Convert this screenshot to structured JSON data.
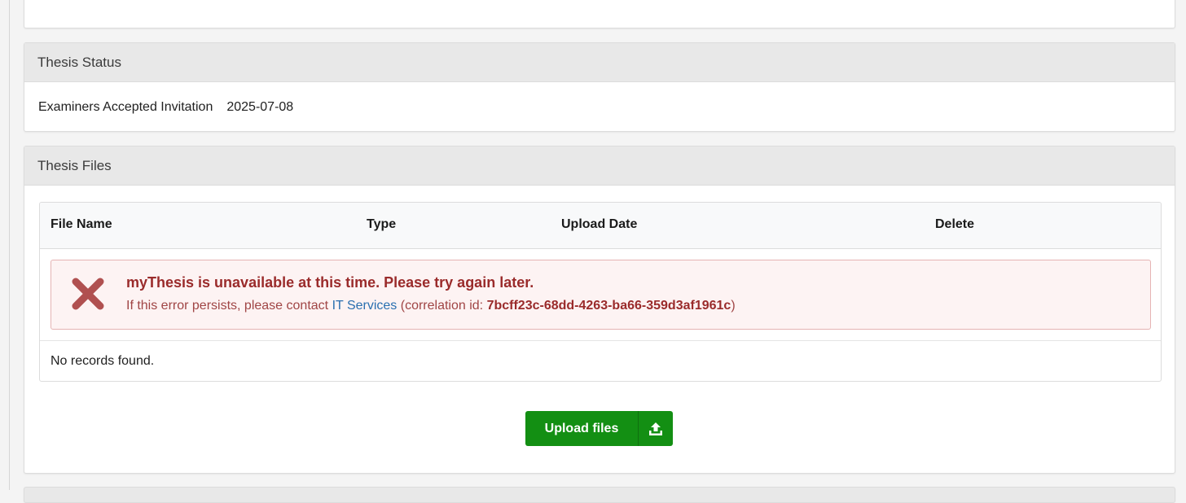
{
  "thesis_status": {
    "heading": "Thesis Status",
    "label": "Examiners Accepted Invitation",
    "date": "2025-07-08"
  },
  "thesis_files": {
    "heading": "Thesis Files",
    "columns": {
      "file_name": "File Name",
      "type": "Type",
      "upload_date": "Upload Date",
      "delete": "Delete"
    },
    "error": {
      "title": "myThesis is unavailable at this time. Please try again later.",
      "prefix": "If this error persists, please contact",
      "link": "IT Services",
      "id_prefix": "(correlation id:",
      "correlation_id": "7bcff23c-68dd-4263-ba66-359d3af1961c",
      "id_suffix": ")",
      "icon": "close-x-icon",
      "color": "#b05050"
    },
    "empty_text": "No records found.",
    "upload_button": {
      "label": "Upload files",
      "icon": "upload-icon",
      "color": "#138f13"
    }
  }
}
